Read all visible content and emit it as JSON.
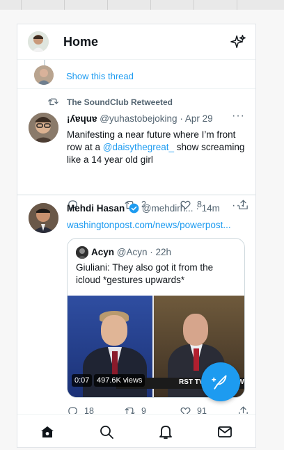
{
  "header": {
    "title": "Home",
    "icons": [
      "user-avatar",
      "sparkle-icon"
    ]
  },
  "thread": {
    "show_thread_label": "Show this thread"
  },
  "tweet1": {
    "retweet_label": "The SoundClub Retweeted",
    "author_name": "¡ʎɐɥuɐ",
    "handle": "@yuhastobejoking",
    "date": "Apr 29",
    "text_part1": "Manifesting a near future where I’m front row at a ",
    "mention": "@daisythegreat_",
    "text_part2": " show screaming like a 14 year old girl",
    "retweets": "2",
    "likes": "8"
  },
  "tweet2": {
    "author_name": "Mehdi Hasan",
    "handle": "@mehdirh...",
    "time": "14m",
    "link": "washingtonpost.com/news/powerpost...",
    "quoted": {
      "author_name": "Acyn",
      "handle": "@Acyn",
      "time": "22h",
      "text": "Giuliani: They also got it from the icloud *gestures upwards*",
      "video": {
        "duration": "0:07",
        "views": "497.6K views",
        "banner_text": "RST TV INTERVIEW SIN"
      }
    },
    "replies": "18",
    "retweets": "9",
    "likes": "91"
  },
  "bottom_nav": {
    "items": [
      "home-icon",
      "search-icon",
      "notifications-icon",
      "messages-icon"
    ]
  },
  "colors": {
    "accent": "#1d9bf0",
    "text": "#0f1419",
    "muted": "#536471",
    "border": "#eff3f4"
  }
}
